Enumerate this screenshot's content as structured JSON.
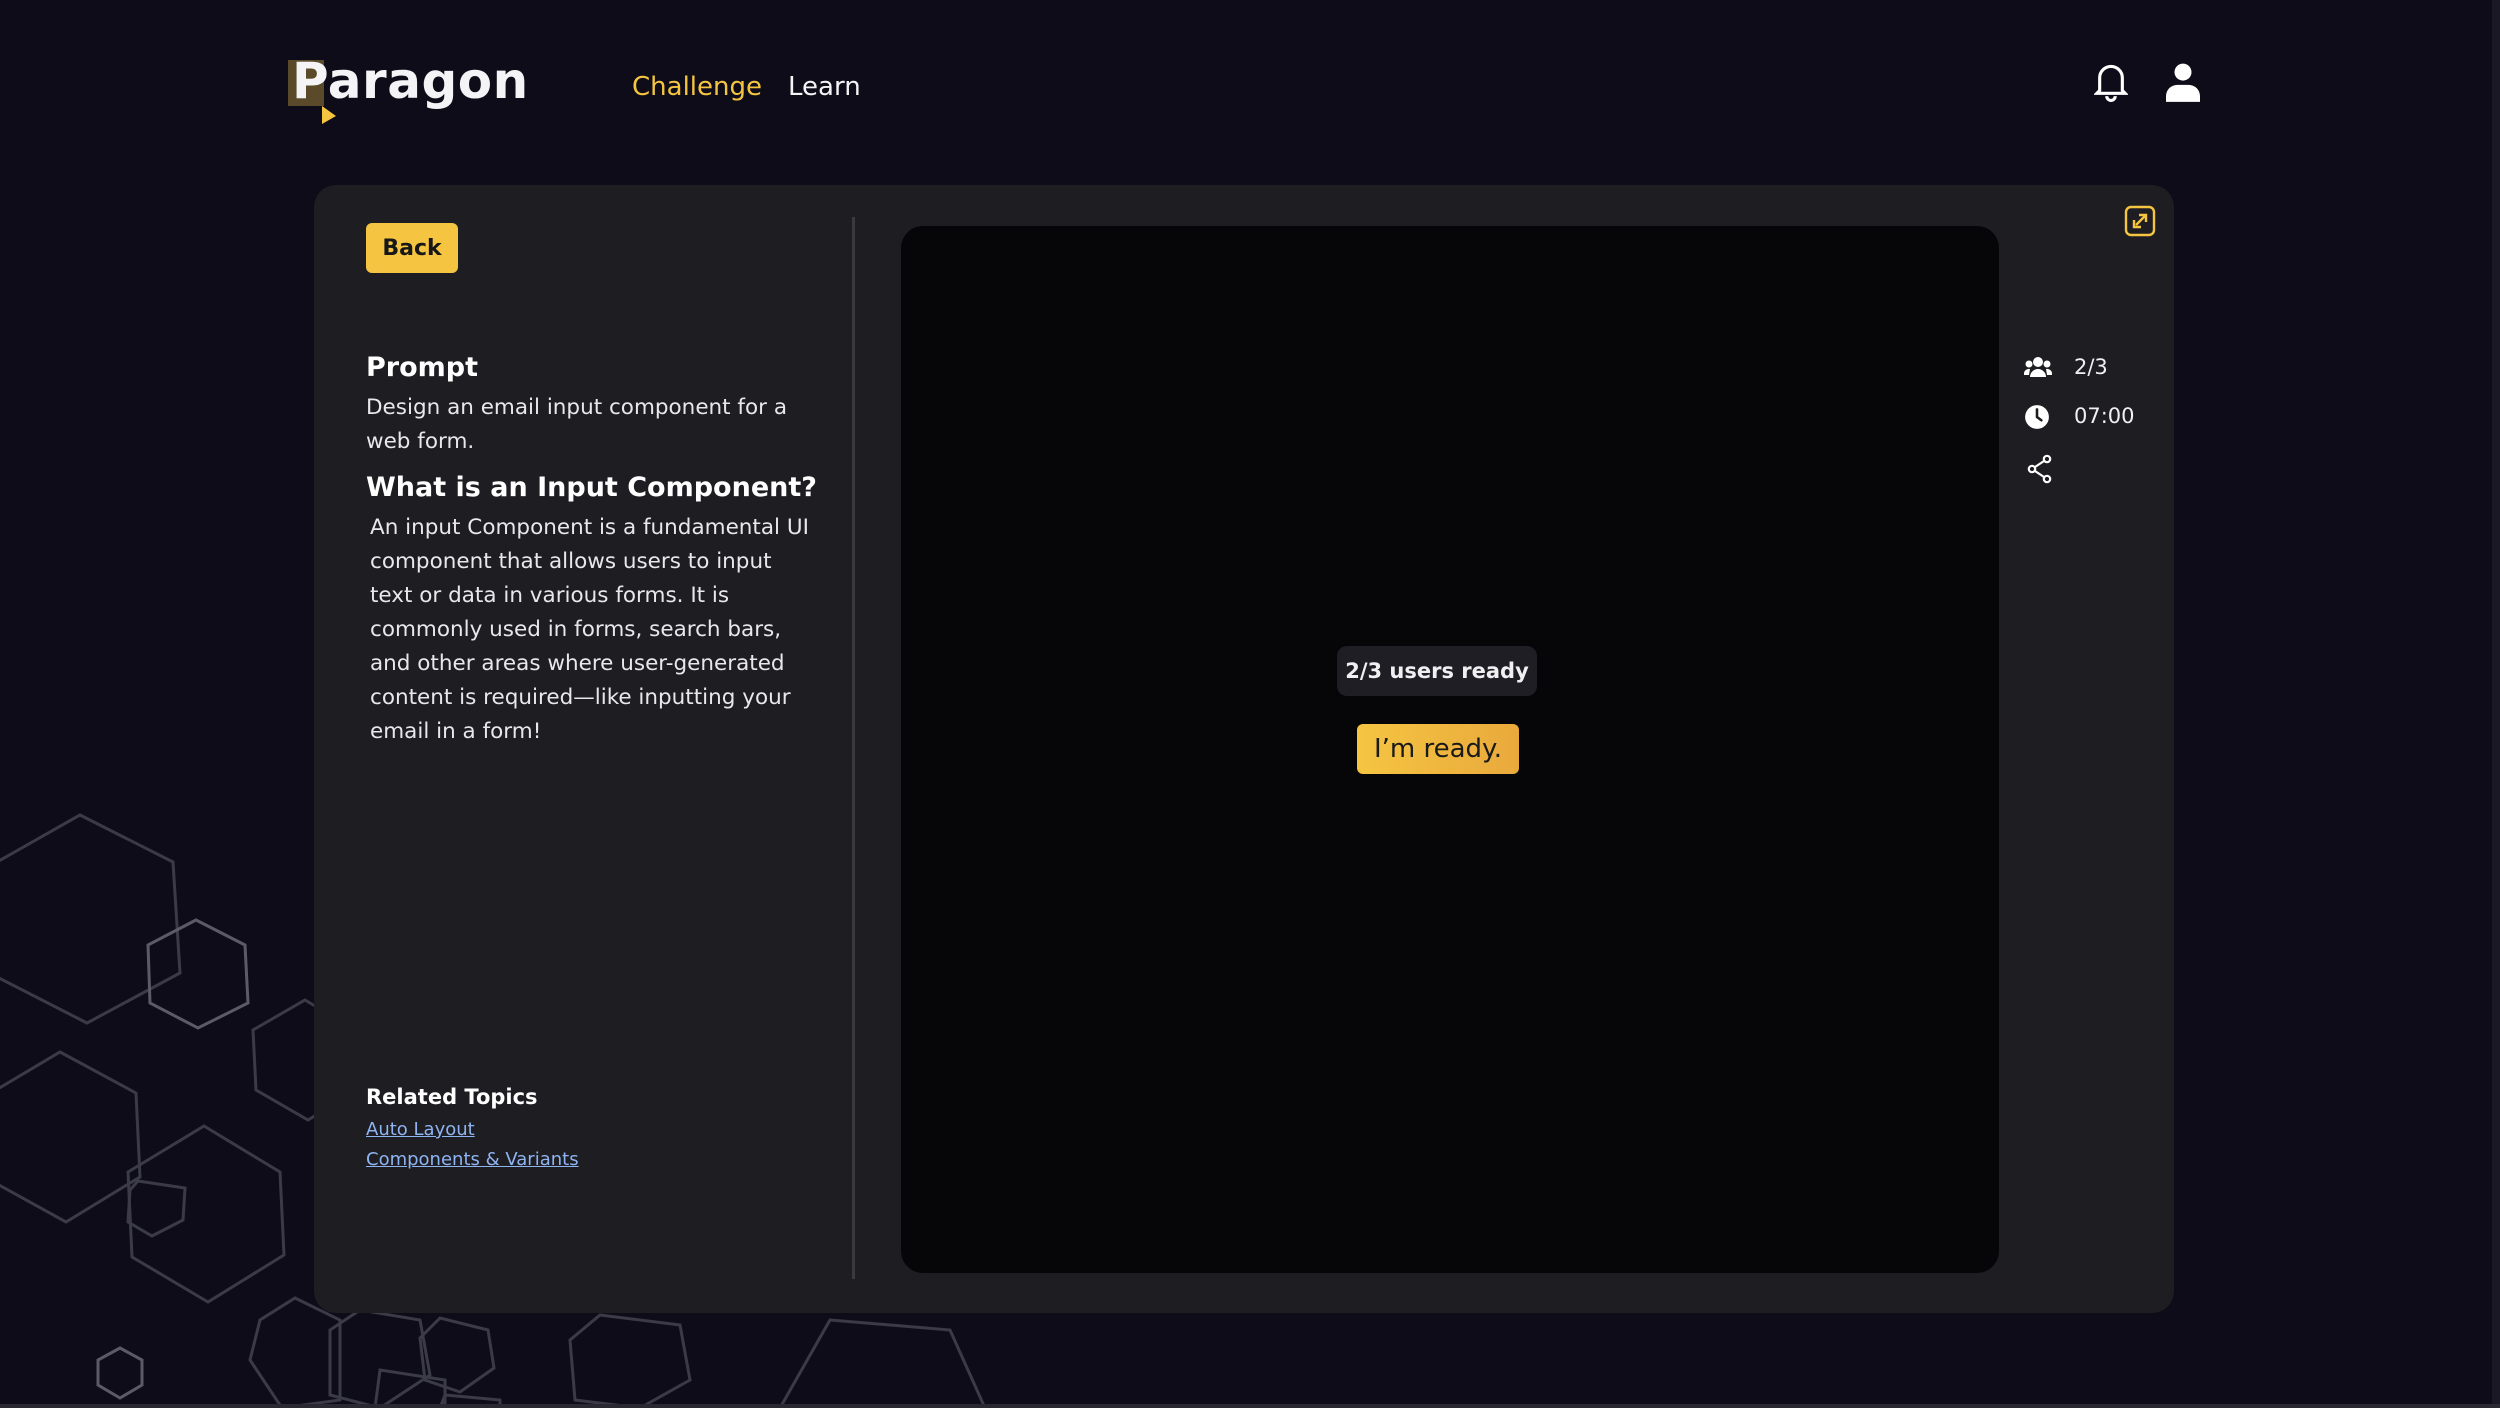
{
  "brand": {
    "logo_text": "Paragon"
  },
  "nav": {
    "challenge": "Challenge",
    "learn": "Learn"
  },
  "colors": {
    "accent": "#f5c542",
    "background": "#0e0c18",
    "card": "#1e1d22",
    "preview": "#060508",
    "link": "#8fb4f2"
  },
  "header_icons": [
    "bell-icon",
    "user-icon"
  ],
  "left_panel": {
    "back_label": "Back",
    "prompt_heading": "Prompt",
    "prompt_text": "Design an email input component for a web form.",
    "what_heading": "What is an Input Component?",
    "what_text": "An input Component is a fundamental UI component that allows users to input text or data in various forms. It is commonly used in forms, search bars, and other areas where user-generated content is required—like inputting your email in a form!",
    "related_heading": "Related Topics",
    "related_links": [
      "Auto Layout",
      "Components & Variants"
    ]
  },
  "preview": {
    "users_ready": "2/3 users ready",
    "ready_button": "I’m ready."
  },
  "stats": {
    "participants": "2/3",
    "timer": "07:00"
  }
}
